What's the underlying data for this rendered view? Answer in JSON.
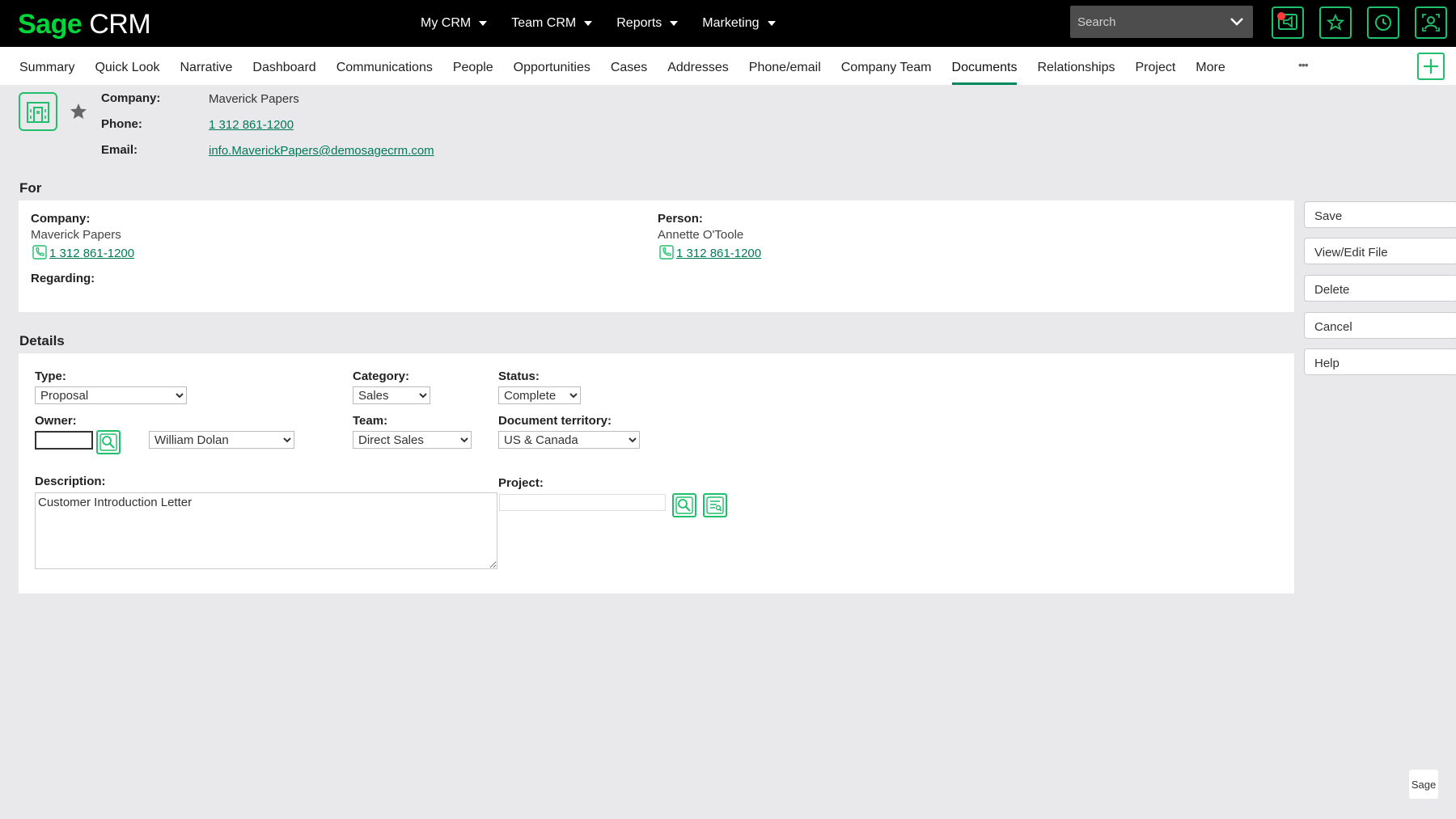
{
  "app": {
    "brand_sage": "Sage",
    "brand_crm": "CRM"
  },
  "topnav": {
    "items": [
      "My CRM",
      "Team CRM",
      "Reports",
      "Marketing"
    ]
  },
  "search": {
    "placeholder": "Search"
  },
  "tabs": [
    "Summary",
    "Quick Look",
    "Narrative",
    "Dashboard",
    "Communications",
    "People",
    "Opportunities",
    "Cases",
    "Addresses",
    "Phone/email",
    "Company Team",
    "Documents",
    "Relationships",
    "Project",
    "More"
  ],
  "active_tab": "Documents",
  "header": {
    "company_label": "Company:",
    "company": "Maverick Papers",
    "phone_label": "Phone:",
    "phone": "1 312 861-1200",
    "email_label": "Email:",
    "email": "info.MaverickPapers@demosagecrm.com"
  },
  "for_section": {
    "title": "For",
    "company_label": "Company:",
    "company": "Maverick Papers",
    "company_phone": "1 312 861-1200",
    "person_label": "Person:",
    "person": "Annette O'Toole",
    "person_phone": "1 312 861-1200",
    "regarding_label": "Regarding:"
  },
  "details": {
    "title": "Details",
    "type_label": "Type:",
    "type": "Proposal",
    "category_label": "Category:",
    "category": "Sales",
    "status_label": "Status:",
    "status": "Complete",
    "owner_label": "Owner:",
    "owner": "William Dolan",
    "team_label": "Team:",
    "team": "Direct Sales",
    "territory_label": "Document territory:",
    "territory": "US & Canada",
    "description_label": "Description:",
    "description": "Customer Introduction Letter",
    "project_label": "Project:"
  },
  "actions": [
    "Save",
    "View/Edit File",
    "Delete",
    "Cancel",
    "Help"
  ],
  "footer": {
    "logo_text": "Sage"
  },
  "colors": {
    "accent": "#1fbf6b",
    "link": "#007a54",
    "topbar": "#000000",
    "badge": "#ff3b3b"
  }
}
